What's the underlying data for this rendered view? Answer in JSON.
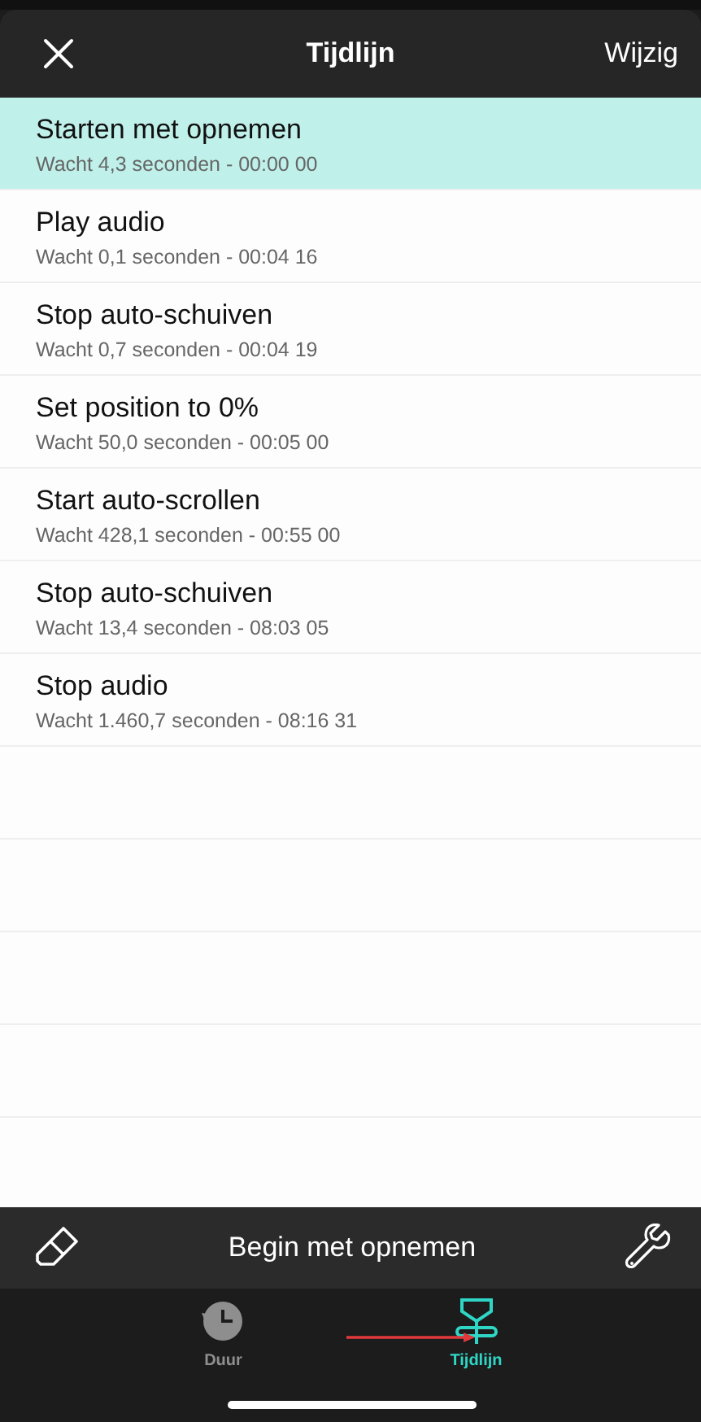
{
  "header": {
    "title": "Tijdlijn",
    "action": "Wijzig"
  },
  "events": [
    {
      "title": "Starten met opnemen",
      "detail": "Wacht 4,3 seconden - 00:00 00",
      "selected": true
    },
    {
      "title": "Play audio",
      "detail": "Wacht 0,1 seconden - 00:04 16",
      "selected": false
    },
    {
      "title": "Stop auto-schuiven",
      "detail": "Wacht 0,7 seconden - 00:04 19",
      "selected": false
    },
    {
      "title": "Set position to 0%",
      "detail": "Wacht 50,0 seconden - 00:05 00",
      "selected": false
    },
    {
      "title": "Start auto-scrollen",
      "detail": "Wacht 428,1 seconden - 00:55 00",
      "selected": false
    },
    {
      "title": "Stop auto-schuiven",
      "detail": "Wacht 13,4 seconden - 08:03 05",
      "selected": false
    },
    {
      "title": "Stop audio",
      "detail": "Wacht 1.460,7 seconden - 08:16 31",
      "selected": false
    }
  ],
  "toolbar": {
    "label": "Begin met opnemen"
  },
  "tabs": [
    {
      "label": "Duur",
      "kind": "clock",
      "selected": false
    },
    {
      "label": "Tijdlijn",
      "kind": "timeline",
      "selected": true
    }
  ]
}
